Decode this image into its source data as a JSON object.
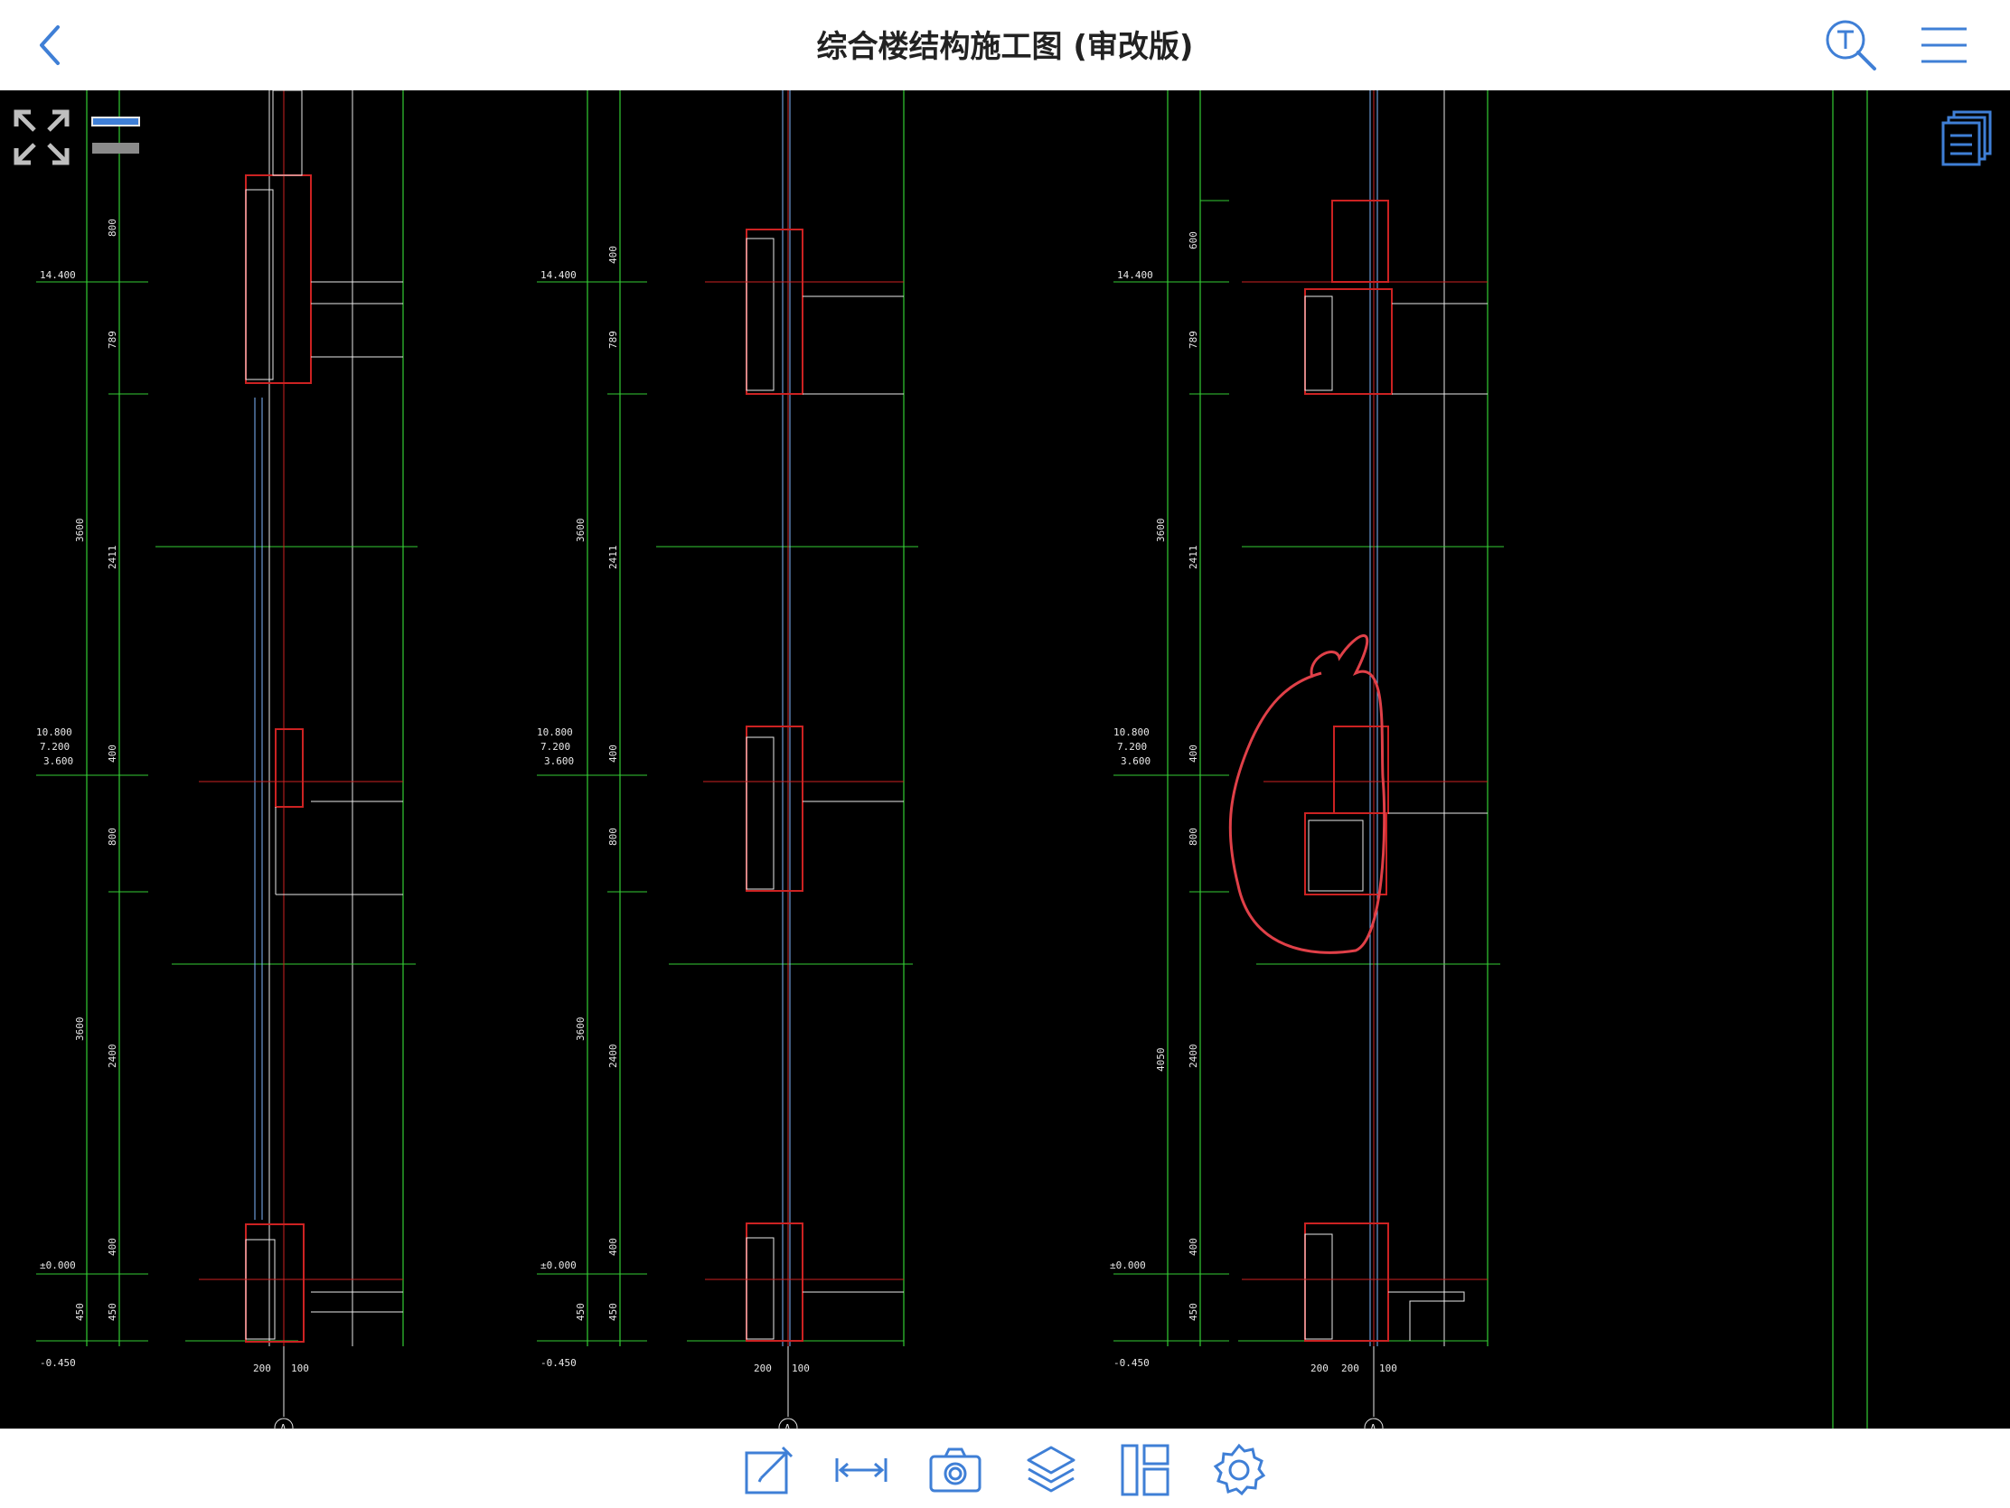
{
  "header": {
    "title": "综合楼结构施工图 (审改版)",
    "back_icon": "chevron-left-icon",
    "search_icon": "text-search-icon",
    "menu_icon": "hamburger-menu-icon"
  },
  "colors": {
    "accent": "#3f7fd6",
    "canvas_bg": "#000000",
    "cad_green": "#33cc33",
    "cad_red": "#cc2222",
    "cad_white": "#e8e8e8",
    "markup_red": "#e04048"
  },
  "canvas_controls": {
    "fullscreen_icon": "expand-arrows-icon",
    "layer_toggle_icon": "toggle-bars-icon",
    "pages_icon": "stacked-pages-icon"
  },
  "drawing": {
    "sections": [
      {
        "elev_top": "14.400",
        "elev_mid_1": "10.800",
        "elev_mid_2": "7.200",
        "elev_mid_3": "3.600",
        "elev_zero": "±0.000",
        "elev_bottom": "-0.450",
        "dim_outer_1": "3600",
        "dim_outer_2": "3600",
        "dims_inner": [
          "800",
          "789",
          "2411",
          "400",
          "800",
          "2400",
          "400",
          "450",
          "450"
        ],
        "bottom_dims": [
          "200",
          "100"
        ],
        "axis": "A"
      },
      {
        "elev_top": "14.400",
        "elev_mid_1": "10.800",
        "elev_mid_2": "7.200",
        "elev_mid_3": "3.600",
        "elev_zero": "±0.000",
        "elev_bottom": "-0.450",
        "dim_outer_1": "3600",
        "dim_outer_2": "3600",
        "dims_inner": [
          "400",
          "789",
          "2411",
          "400",
          "800",
          "2400",
          "400",
          "450",
          "450"
        ],
        "bottom_dims": [
          "200",
          "100"
        ],
        "axis": "A"
      },
      {
        "elev_top": "14.400",
        "elev_mid_1": "10.800",
        "elev_mid_2": "7.200",
        "elev_mid_3": "3.600",
        "elev_zero": "±0.000",
        "elev_bottom": "-0.450",
        "dim_outer_1": "3600",
        "dim_outer_2": "4050",
        "dims_inner": [
          "600",
          "789",
          "2411",
          "400",
          "800",
          "2400",
          "400",
          "450"
        ],
        "bottom_dims": [
          "200",
          "200",
          "100"
        ],
        "axis": "A"
      }
    ]
  },
  "toolbar": [
    {
      "name": "markup-tool",
      "icon": "pencil-edit-icon"
    },
    {
      "name": "measure-tool",
      "icon": "measure-arrows-icon"
    },
    {
      "name": "snapshot-tool",
      "icon": "camera-icon"
    },
    {
      "name": "layers-tool",
      "icon": "layers-icon"
    },
    {
      "name": "layout-tool",
      "icon": "layout-panels-icon"
    },
    {
      "name": "settings-tool",
      "icon": "gear-icon"
    }
  ]
}
